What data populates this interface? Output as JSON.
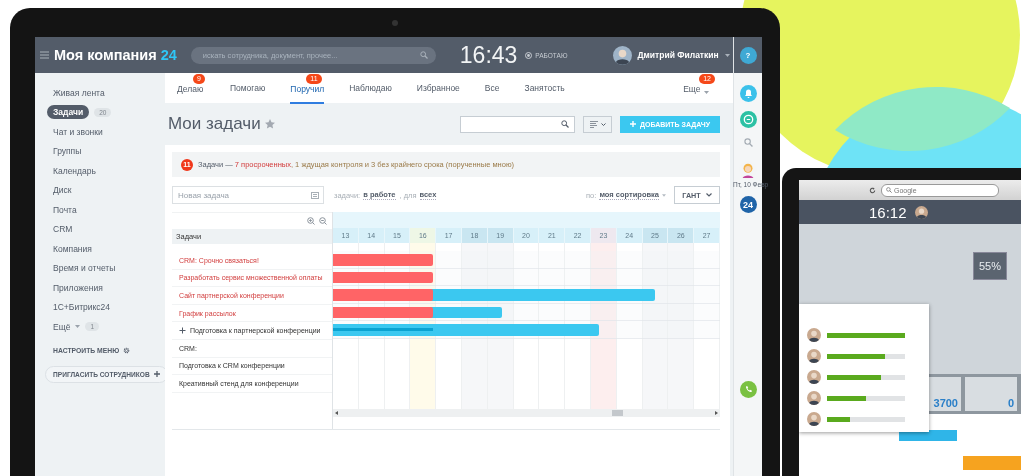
{
  "header": {
    "logo_name": "Моя компания",
    "logo_suffix": "24",
    "search_placeholder": "искать сотрудника, документ, прочее...",
    "time": "16:43",
    "status": "РАБОТАЮ",
    "user": "Дмитрий Филаткин"
  },
  "sidebar": {
    "items": [
      {
        "label": "Живая лента",
        "selected": false
      },
      {
        "label": "Задачи",
        "selected": true,
        "count": "20"
      },
      {
        "label": "Чат и звонки",
        "selected": false
      },
      {
        "label": "Группы",
        "selected": false
      },
      {
        "label": "Календарь",
        "selected": false
      },
      {
        "label": "Диск",
        "selected": false
      },
      {
        "label": "Почта",
        "selected": false
      },
      {
        "label": "CRM",
        "selected": false
      },
      {
        "label": "Компания",
        "selected": false
      },
      {
        "label": "Время и отчеты",
        "selected": false
      },
      {
        "label": "Приложения",
        "selected": false
      },
      {
        "label": "1С+Битрикс24",
        "selected": false
      }
    ],
    "more": {
      "label": "Ещё",
      "count": "1"
    },
    "configure": "НАСТРОИТЬ МЕНЮ",
    "invite": "ПРИГЛАСИТЬ СОТРУДНИКОВ"
  },
  "tabs": [
    {
      "label": "Делаю",
      "selected": false,
      "kind": "tab",
      "badge": "9"
    },
    {
      "label": "Помогаю",
      "selected": false,
      "kind": "tab"
    },
    {
      "label": "Поручил",
      "selected": true,
      "kind": "tab",
      "badge": "11"
    },
    {
      "label": "Наблюдаю",
      "selected": false,
      "kind": "tab"
    },
    {
      "label": "Избранное",
      "selected": false,
      "kind": "tab"
    },
    {
      "label": "Все",
      "selected": false,
      "kind": "tab"
    },
    {
      "label": "Занятость",
      "selected": false,
      "kind": "tab"
    },
    {
      "label": "Еще",
      "selected": false,
      "kind": "menu",
      "badge": "12"
    }
  ],
  "page": {
    "title": "Мои задачи",
    "add_button": "ДОБАВИТЬ ЗАДАЧУ"
  },
  "notice": {
    "count": "11",
    "prefix": "Задачи —",
    "link": "7 просроченных",
    "rest": ", 1 ждущая контроля и 3 без крайнего срока (порученные мною)"
  },
  "filters": {
    "new_task_placeholder": "Новая задача",
    "status_label": "задачи:",
    "status_value": "в работе",
    "for_label": ", для",
    "for_value": "всех",
    "sort_label": "по:",
    "sort_value": "моя сортировка",
    "view": "ГАНТ"
  },
  "gantt": {
    "column_header": "Задачи",
    "days": [
      {
        "label": "13",
        "kind": "workday"
      },
      {
        "label": "14",
        "kind": "workday"
      },
      {
        "label": "15",
        "kind": "workday"
      },
      {
        "label": "16",
        "kind": "today"
      },
      {
        "label": "17",
        "kind": "workday"
      },
      {
        "label": "18",
        "kind": "weekend"
      },
      {
        "label": "19",
        "kind": "weekend"
      },
      {
        "label": "20",
        "kind": "workday"
      },
      {
        "label": "21",
        "kind": "workday"
      },
      {
        "label": "22",
        "kind": "workday"
      },
      {
        "label": "23",
        "kind": "holiday"
      },
      {
        "label": "24",
        "kind": "workday"
      },
      {
        "label": "25",
        "kind": "weekend"
      },
      {
        "label": "26",
        "kind": "weekend"
      },
      {
        "label": "27",
        "kind": "workday"
      }
    ],
    "tasks": [
      {
        "title": "CRM: Срочно связаться!",
        "kind": "task",
        "overdue": true,
        "bars": [
          {
            "kind": "overdue",
            "level": 0.258
          }
        ]
      },
      {
        "title": "Разработать сервис множественной оплаты",
        "kind": "task",
        "overdue": true,
        "bars": [
          {
            "kind": "overdue",
            "level": 0.258
          }
        ]
      },
      {
        "title": "Сайт партнерской конференции",
        "kind": "task",
        "overdue": true,
        "bars": [
          {
            "kind": "active",
            "level": 0.832
          },
          {
            "kind": "overdue",
            "level": 0.258
          }
        ]
      },
      {
        "title": "График рассылок",
        "kind": "task",
        "overdue": true,
        "bars": [
          {
            "kind": "active",
            "level": 0.437
          },
          {
            "kind": "overdue",
            "level": 0.258
          }
        ]
      },
      {
        "title": "Подготовка к партнерской конференции",
        "kind": "group",
        "overdue": false,
        "bars": [
          {
            "kind": "active",
            "level": 0.687
          },
          {
            "kind": "progress",
            "level": 0.258
          }
        ]
      },
      {
        "title": "CRM:",
        "kind": "task",
        "overdue": false
      },
      {
        "title": "Подготовка к CRM конференции",
        "kind": "task",
        "overdue": false
      },
      {
        "title": "Креативный стенд для конференции",
        "kind": "task",
        "overdue": false
      }
    ]
  },
  "rail": {
    "help": "?",
    "date": "Пт, 10 Февр",
    "logo": "24"
  },
  "second_screen": {
    "search": "Google",
    "time": "16:12",
    "gauge": "55%",
    "tiles": [
      "3700",
      "0"
    ],
    "ratings": [
      {
        "level": 1
      },
      {
        "level": 0.74
      },
      {
        "level": 0.69
      },
      {
        "level": 0.5
      },
      {
        "level": 0.3
      }
    ]
  }
}
